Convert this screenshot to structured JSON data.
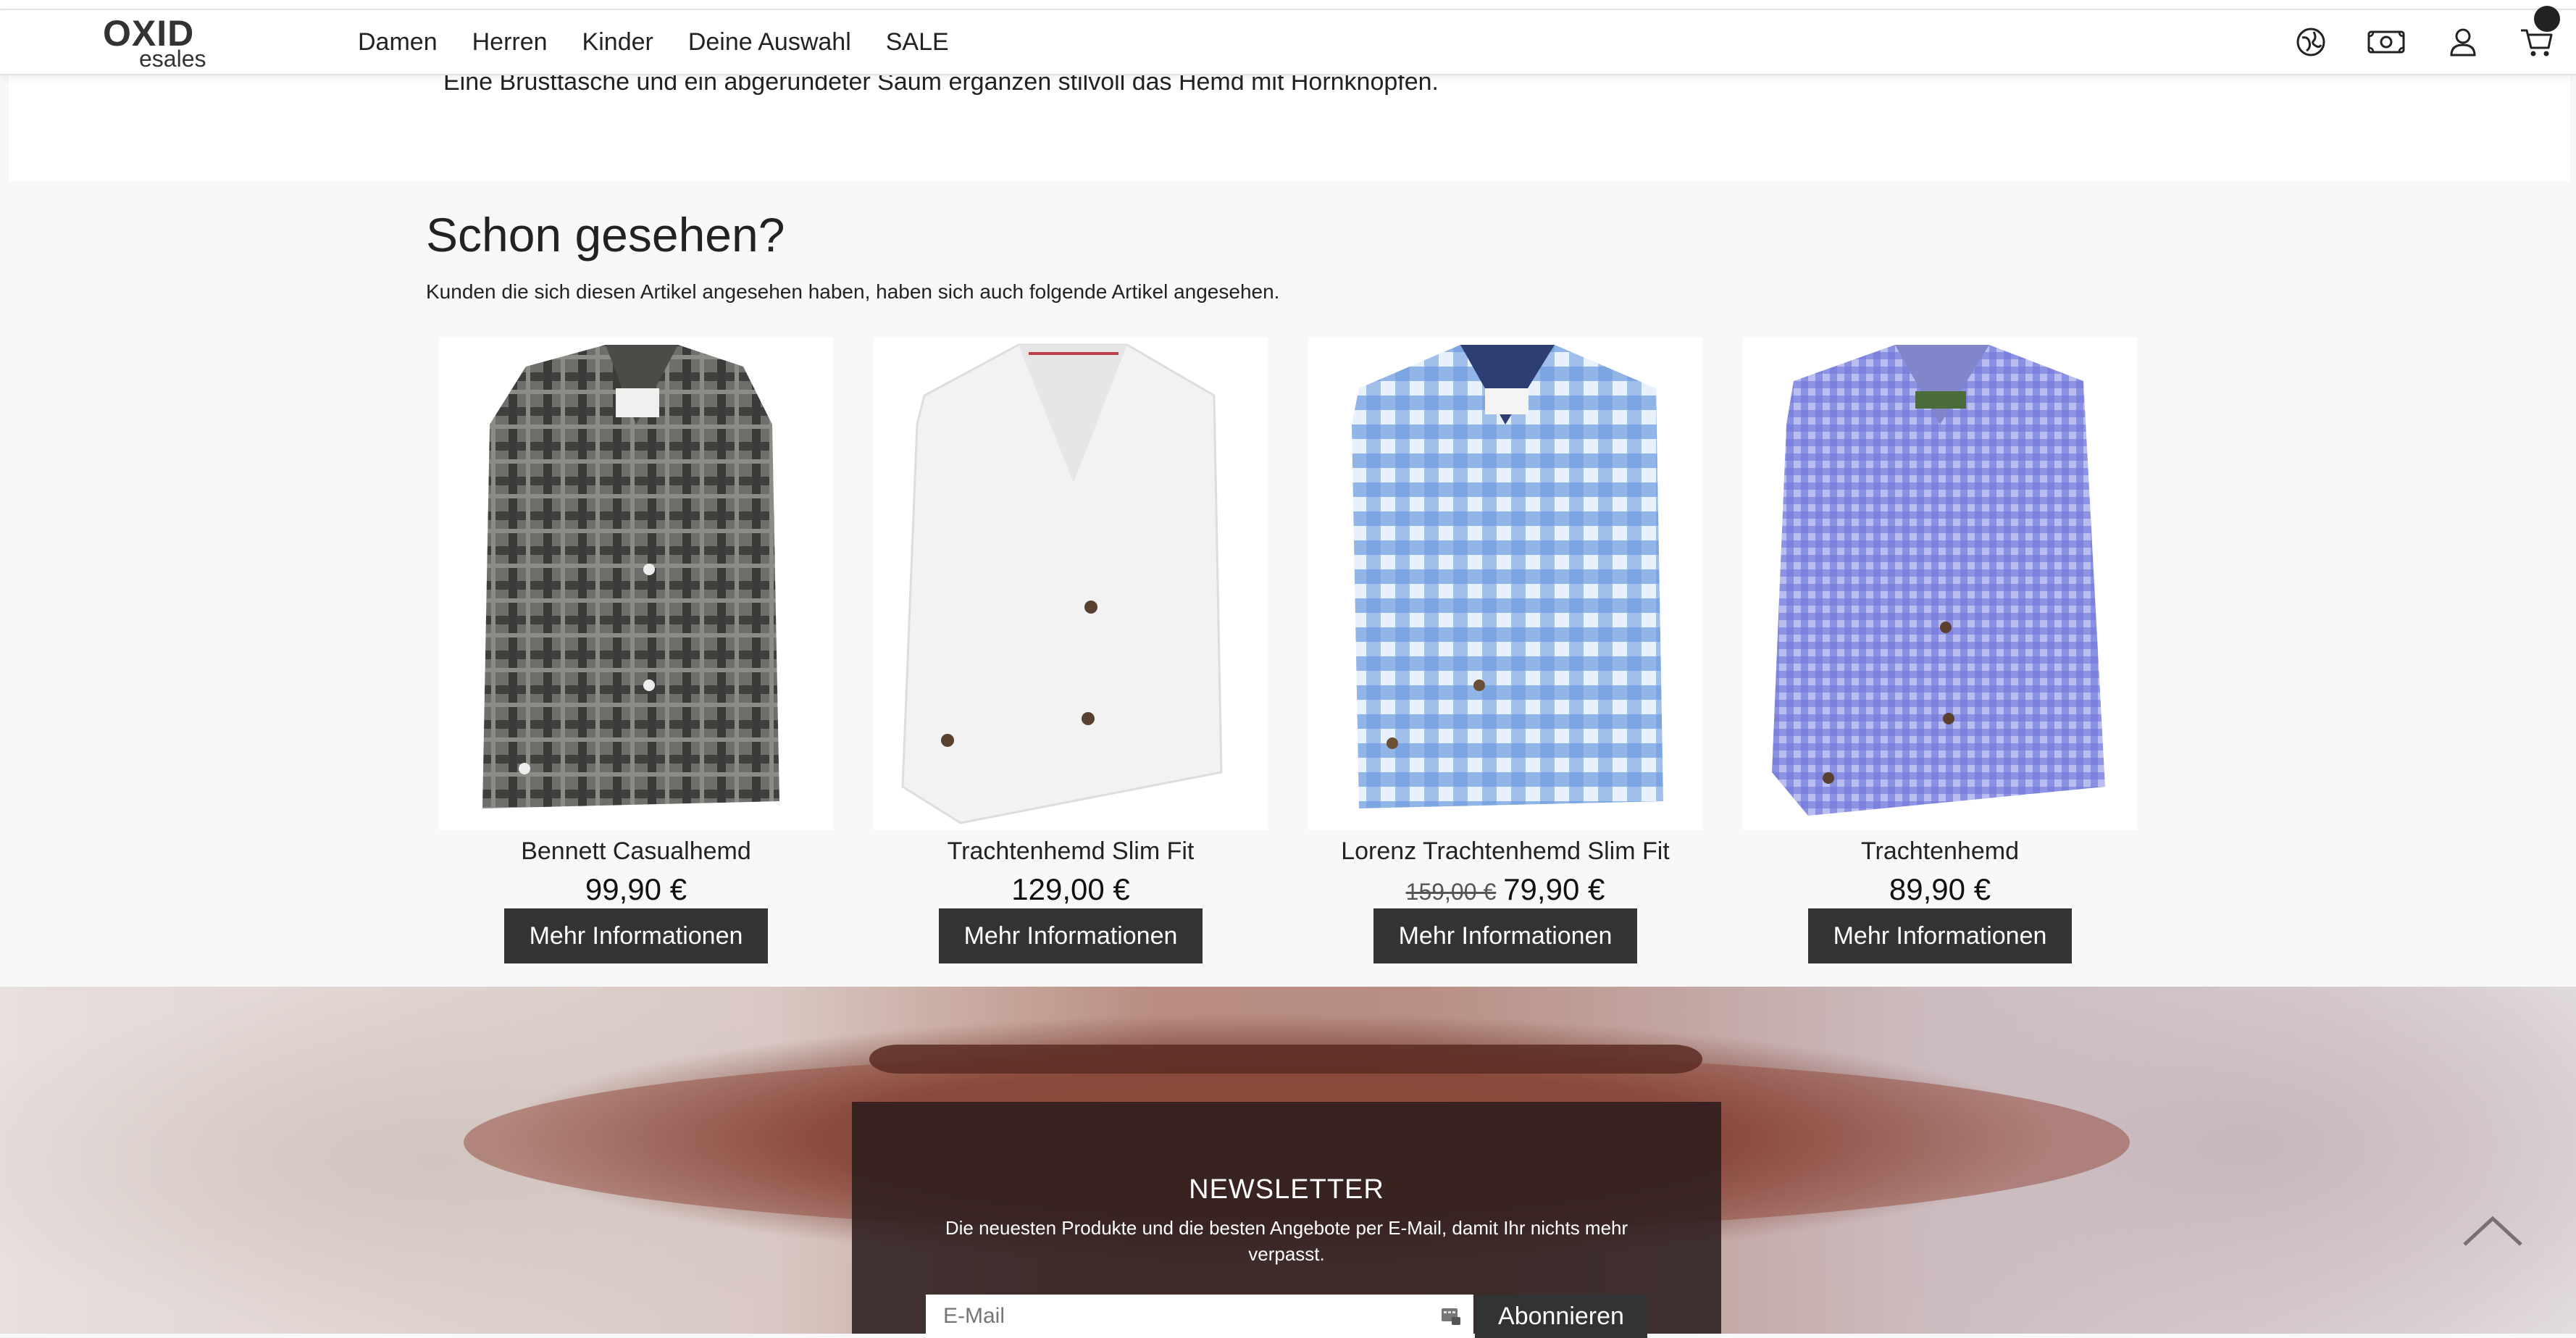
{
  "header": {
    "logo_main": "OXID",
    "logo_sub": "esales",
    "nav": [
      "Damen",
      "Herren",
      "Kinder",
      "Deine Auswahl",
      "SALE"
    ],
    "icons": [
      "language-globe-icon",
      "currency-money-icon",
      "account-user-icon",
      "cart-icon"
    ]
  },
  "description": {
    "text": "Eine Brusttasche und ein abgerundeter Saum ergänzen stilvoll das Hemd mit Hornknöpfen."
  },
  "recommendations": {
    "title": "Schon gesehen?",
    "subtitle": "Kunden die sich diesen Artikel angesehen haben, haben sich auch folgende Artikel angesehen.",
    "products": [
      {
        "name": "Bennett Casualhemd",
        "price": "99,90 €",
        "old_price": "",
        "button": "Mehr Informationen",
        "pattern": "dark-gray-check"
      },
      {
        "name": "Trachtenhemd Slim Fit",
        "price": "129,00 €",
        "old_price": "",
        "button": "Mehr Informationen",
        "pattern": "white"
      },
      {
        "name": "Lorenz Trachtenhemd Slim Fit",
        "price": "79,90 €",
        "old_price": "159,00 €",
        "button": "Mehr Informationen",
        "pattern": "blue-gingham"
      },
      {
        "name": "Trachtenhemd",
        "price": "89,90 €",
        "old_price": "",
        "button": "Mehr Informationen",
        "pattern": "lavender-small-check"
      }
    ]
  },
  "newsletter": {
    "title": "NEWSLETTER",
    "text": "Die neuesten Produkte und die besten Angebote per E-Mail, damit Ihr nichts mehr verpasst.",
    "email_placeholder": "E-Mail",
    "subscribe_label": "Abonnieren"
  },
  "colors": {
    "button_bg": "#333333",
    "newsletter_box": "#2c1e1e",
    "accent_text": "#222222"
  }
}
